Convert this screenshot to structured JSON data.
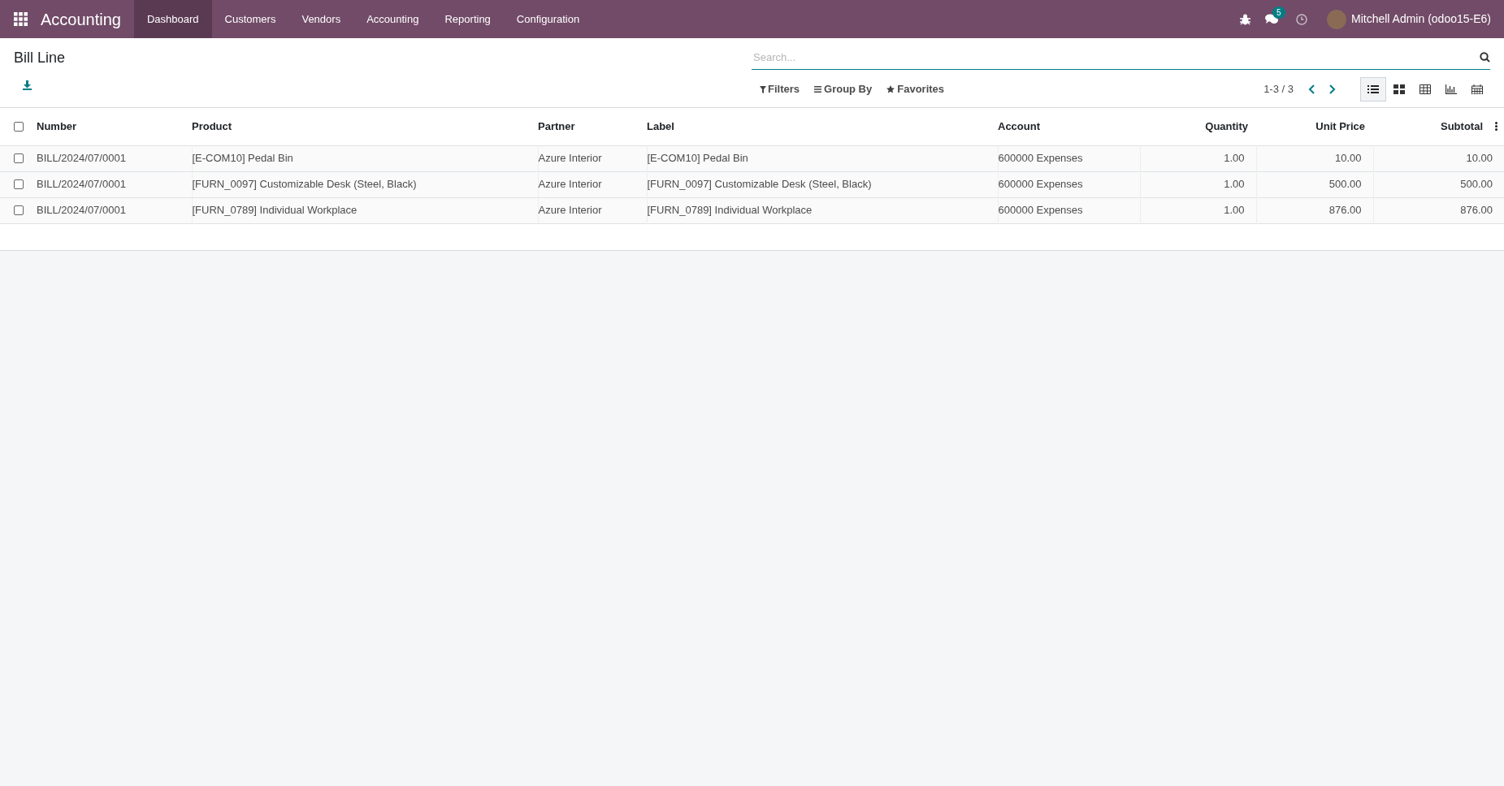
{
  "navbar": {
    "app_title": "Accounting",
    "menu": [
      {
        "label": "Dashboard",
        "selected": true
      },
      {
        "label": "Customers",
        "selected": false
      },
      {
        "label": "Vendors",
        "selected": false
      },
      {
        "label": "Accounting",
        "selected": false
      },
      {
        "label": "Reporting",
        "selected": false
      },
      {
        "label": "Configuration",
        "selected": false
      }
    ],
    "messages_badge": "5",
    "user": "Mitchell Admin (odoo15-E6)"
  },
  "control_panel": {
    "title": "Bill Line",
    "search": {
      "placeholder": "Search..."
    },
    "filters": [
      "Filters",
      "Group By",
      "Favorites"
    ],
    "pager": "1-3 / 3",
    "views": [
      {
        "kind": "list",
        "selected": true
      },
      {
        "kind": "kanban",
        "selected": false
      },
      {
        "kind": "pivot",
        "selected": false
      },
      {
        "kind": "graph",
        "selected": false
      },
      {
        "kind": "calendar",
        "selected": false
      }
    ]
  },
  "table": {
    "select_all": {
      "checked": false
    },
    "columns": [
      {
        "label": "Number"
      },
      {
        "label": "Product"
      },
      {
        "label": "Partner"
      },
      {
        "label": "Label"
      },
      {
        "label": "Account"
      },
      {
        "label": "Quantity"
      },
      {
        "label": "Unit Price"
      },
      {
        "label": "Subtotal"
      }
    ],
    "rows": [
      {
        "checked": false,
        "cells": [
          "BILL/2024/07/0001",
          "[E-COM10] Pedal Bin",
          "Azure Interior",
          "[E-COM10] Pedal Bin",
          "600000 Expenses",
          "1.00",
          "10.00",
          "10.00"
        ]
      },
      {
        "checked": false,
        "cells": [
          "BILL/2024/07/0001",
          "[FURN_0097] Customizable Desk (Steel, Black)",
          "Azure Interior",
          "[FURN_0097] Customizable Desk (Steel, Black)",
          "600000 Expenses",
          "1.00",
          "500.00",
          "500.00"
        ]
      },
      {
        "checked": false,
        "cells": [
          "BILL/2024/07/0001",
          "[FURN_0789] Individual Workplace",
          "Azure Interior",
          "[FURN_0789] Individual Workplace",
          "600000 Expenses",
          "1.00",
          "876.00",
          "876.00"
        ]
      }
    ]
  }
}
